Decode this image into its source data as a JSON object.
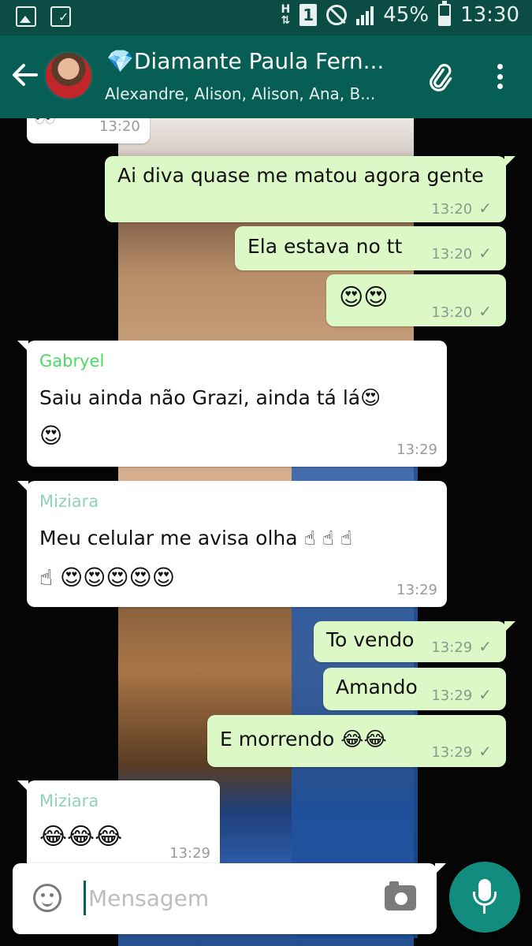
{
  "status_bar": {
    "sim_label": "H",
    "sim_slot": "1",
    "battery_level": 0.45,
    "battery_text": "45%",
    "clock": "13:30"
  },
  "header": {
    "title": "💎Diamante Paula Fern...",
    "subtitle": "Alexandre, Alison, Alison, Ana, B...",
    "back_icon": "arrow-left-icon",
    "attach_icon": "paperclip-icon",
    "more_icon": "more-vert-icon"
  },
  "messages": [
    {
      "direction": "in",
      "sender": "",
      "text": "👀",
      "time": "13:20",
      "read": false
    },
    {
      "direction": "out",
      "text": "Ai diva quase me matou agora gente",
      "time": "13:20",
      "read": true
    },
    {
      "direction": "out",
      "text": "Ela estava no tt",
      "time": "13:20",
      "read": true
    },
    {
      "direction": "out",
      "text": "😍😍",
      "time": "13:20",
      "read": true
    },
    {
      "direction": "in",
      "sender": "Gabryel",
      "sender_color": "#4cd964",
      "text_line1": "Saiu ainda não Grazi, ainda tá lá😍",
      "text_line2": "😍",
      "time": "13:29"
    },
    {
      "direction": "in",
      "sender": "Miziara",
      "sender_color": "#8fd3b6",
      "text_line1": "Meu celular me avisa olha ☝ ☝ ☝",
      "text_line2": "☝ 😍😍😍😍😍",
      "time": "13:29"
    },
    {
      "direction": "out",
      "text": "To vendo",
      "time": "13:29",
      "read": true
    },
    {
      "direction": "out",
      "text": "Amando",
      "time": "13:29",
      "read": true
    },
    {
      "direction": "out",
      "text": "E morrendo 😂😂",
      "time": "13:29",
      "read": true
    },
    {
      "direction": "in",
      "sender": "Miziara",
      "sender_color": "#8fd3b6",
      "text": "😂😂😂",
      "time": "13:29"
    }
  ],
  "composer": {
    "placeholder": "Mensagem",
    "emoji_icon": "smiley-icon",
    "camera_icon": "camera-icon",
    "mic_icon": "microphone-icon"
  },
  "colors": {
    "app_bar": "#075e54",
    "status_bar": "#0b4d44",
    "outgoing_bubble": "#dcf8c6",
    "incoming_bubble": "#ffffff",
    "fab": "#128c7e"
  }
}
